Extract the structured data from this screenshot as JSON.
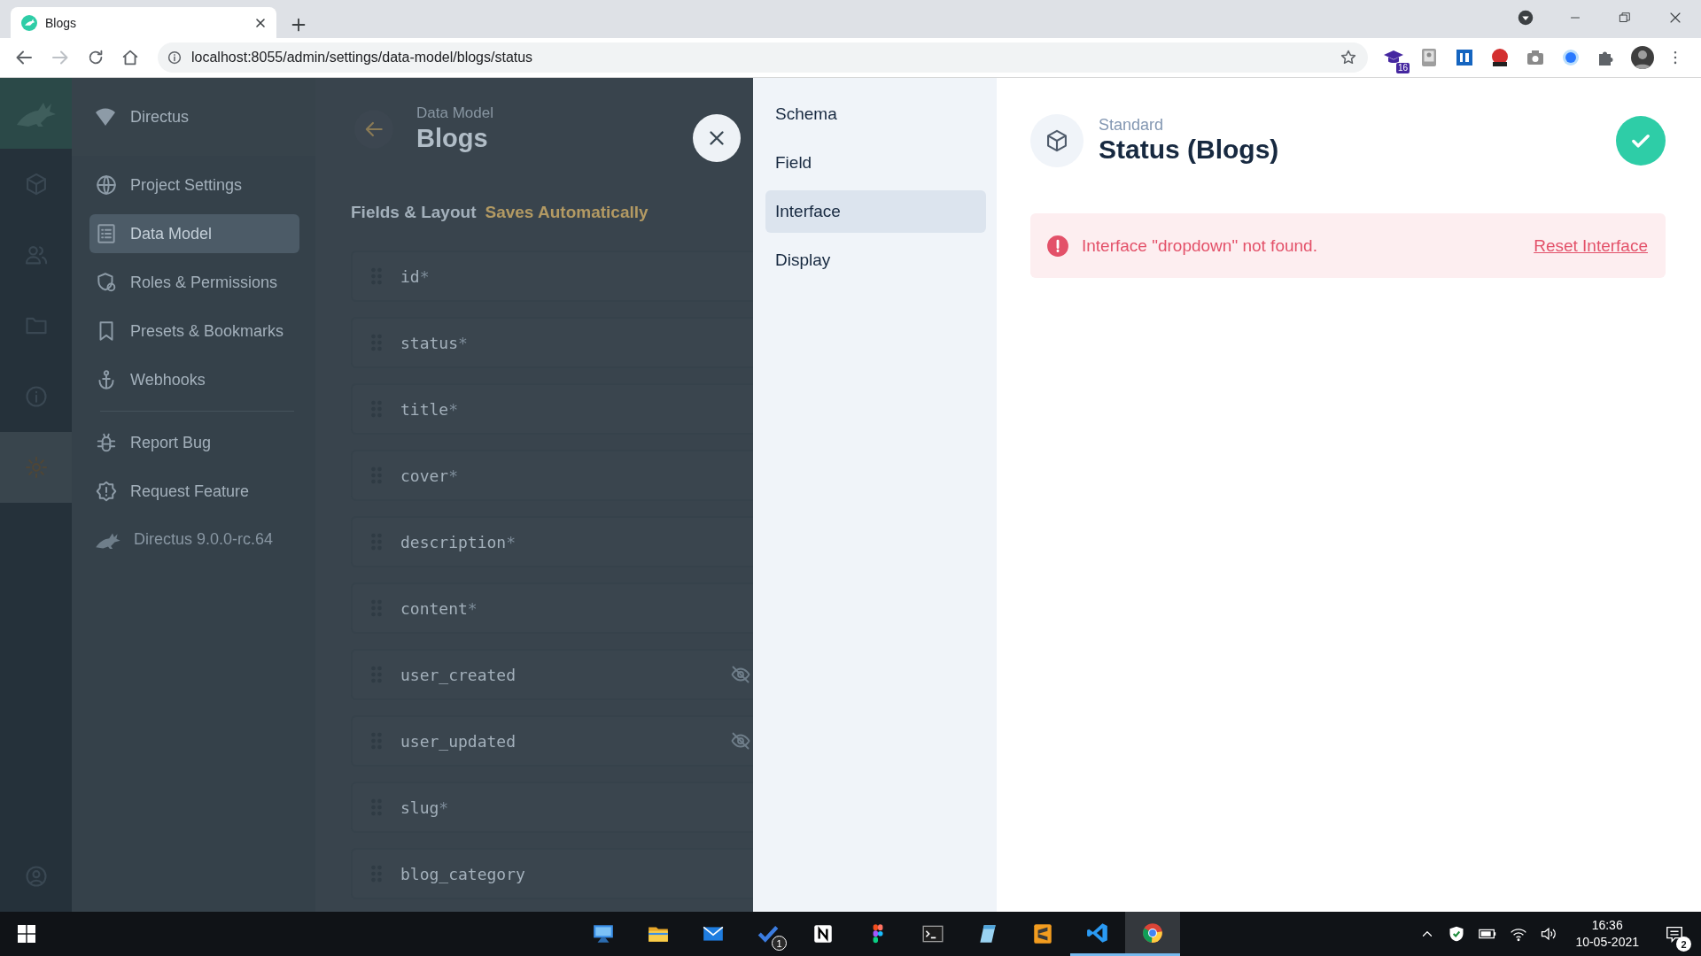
{
  "browser": {
    "tab": {
      "title": "Blogs"
    },
    "url": "localhost:8055/admin/settings/data-model/blogs/status",
    "forward_disabled": true,
    "extensions": [
      {
        "kind": "cap",
        "badge": "16"
      },
      {
        "kind": "photo"
      },
      {
        "kind": "square"
      },
      {
        "kind": "seo"
      },
      {
        "kind": "camera"
      },
      {
        "kind": "dot"
      },
      {
        "kind": "puzzle"
      }
    ]
  },
  "module_nav": [
    {
      "kind": "box",
      "selected": false
    },
    {
      "kind": "users",
      "selected": false
    },
    {
      "kind": "folder",
      "selected": false
    },
    {
      "kind": "info",
      "selected": false
    },
    {
      "kind": "gear",
      "selected": true
    }
  ],
  "sidebar": {
    "title": "Directus",
    "sections": [
      {
        "items": [
          {
            "label": "Project Settings",
            "kind": "globe",
            "selected": false
          },
          {
            "label": "Data Model",
            "kind": "list",
            "selected": true
          },
          {
            "label": "Roles & Permissions",
            "kind": "shield",
            "selected": false
          },
          {
            "label": "Presets & Bookmarks",
            "kind": "bookmark",
            "selected": false
          },
          {
            "label": "Webhooks",
            "kind": "anchor",
            "selected": false
          }
        ]
      },
      {
        "items": [
          {
            "label": "Report Bug",
            "kind": "bug",
            "selected": false
          },
          {
            "label": "Request Feature",
            "kind": "alert",
            "selected": false
          }
        ]
      }
    ],
    "version": "Directus 9.0.0-rc.64"
  },
  "main": {
    "breadcrumb": "Data Model",
    "title": "Blogs",
    "section_title": "Fields & Layout",
    "section_note": "Saves Automatically",
    "fields": [
      {
        "name": "id",
        "mark": "*",
        "hidden": false
      },
      {
        "name": "status",
        "mark": "*",
        "hidden": false
      },
      {
        "name": "title",
        "mark": "*",
        "hidden": false
      },
      {
        "name": "cover",
        "mark": "*",
        "hidden": false
      },
      {
        "name": "description",
        "mark": "*",
        "hidden": false
      },
      {
        "name": "content",
        "mark": "*",
        "hidden": false
      },
      {
        "name": "user_created",
        "hidden": true
      },
      {
        "name": "user_updated",
        "hidden": true
      },
      {
        "name": "slug",
        "mark": "*",
        "hidden": false
      },
      {
        "name": "blog_category",
        "hidden": false
      }
    ]
  },
  "drawer": {
    "tabs": [
      {
        "label": "Schema",
        "selected": false
      },
      {
        "label": "Field",
        "selected": false
      },
      {
        "label": "Interface",
        "selected": true
      },
      {
        "label": "Display",
        "selected": false
      }
    ],
    "subtitle": "Standard",
    "title": "Status (Blogs)",
    "notice": {
      "text": "Interface \"dropdown\" not found.",
      "action": "Reset Interface"
    }
  },
  "taskbar": {
    "apps": [
      {
        "kind": "computer",
        "running": false,
        "selected": false
      },
      {
        "kind": "folder",
        "running": false,
        "selected": false
      },
      {
        "kind": "mail",
        "running": false,
        "selected": false
      },
      {
        "kind": "todo",
        "running": false,
        "selected": false,
        "badge": "1"
      },
      {
        "kind": "notion",
        "running": false,
        "selected": false
      },
      {
        "kind": "figma",
        "running": false,
        "selected": false
      },
      {
        "kind": "terminal",
        "running": false,
        "selected": false
      },
      {
        "kind": "notepad",
        "running": false,
        "selected": false
      },
      {
        "kind": "sublime",
        "running": false,
        "selected": false
      },
      {
        "kind": "vscode",
        "running": true,
        "selected": false
      },
      {
        "kind": "chrome",
        "running": true,
        "selected": true
      }
    ],
    "time": "16:36",
    "date": "10-05-2021",
    "notifications": "2"
  }
}
